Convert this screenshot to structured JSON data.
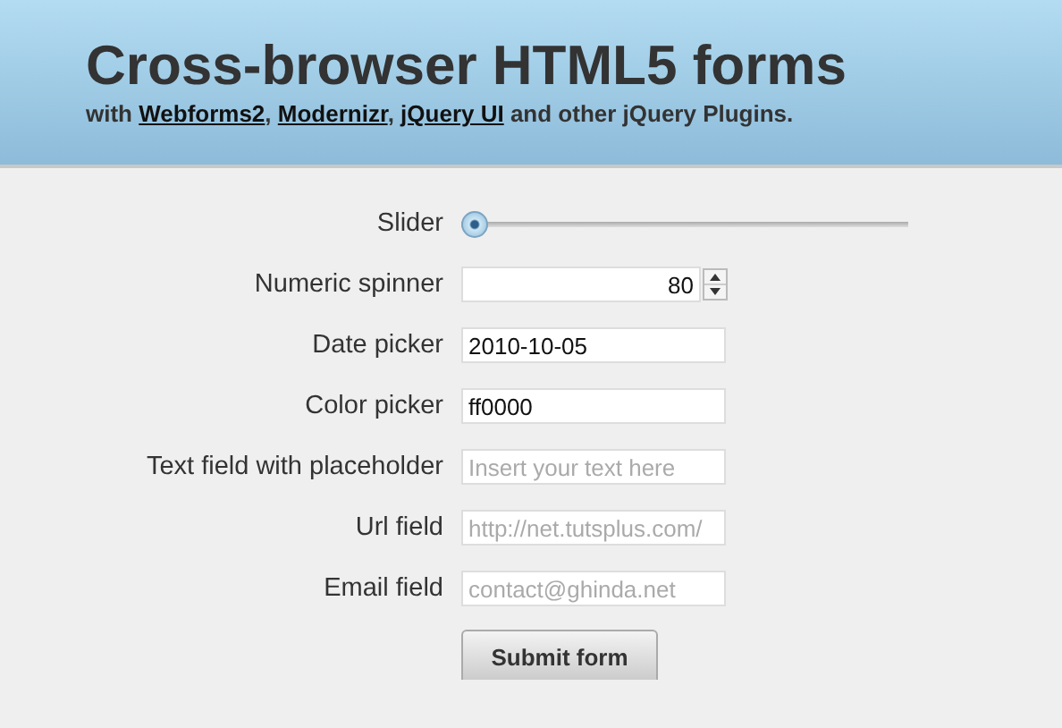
{
  "header": {
    "title": "Cross-browser HTML5 forms",
    "subtitle": [
      {
        "kind": "text",
        "text": "with "
      },
      {
        "kind": "link",
        "text": "Webforms2"
      },
      {
        "kind": "text",
        "text": ", "
      },
      {
        "kind": "link",
        "text": "Modernizr"
      },
      {
        "kind": "text",
        "text": ", "
      },
      {
        "kind": "link",
        "text": "jQuery UI"
      },
      {
        "kind": "text",
        "text": " and other jQuery Plugins."
      }
    ]
  },
  "form": {
    "fields": [
      {
        "kind": "slider",
        "label": "Slider",
        "level": 0
      },
      {
        "kind": "spinner",
        "label": "Numeric spinner",
        "value": "80"
      },
      {
        "kind": "text",
        "label": "Date picker",
        "value": "2010-10-05"
      },
      {
        "kind": "text",
        "label": "Color picker",
        "value": "ff0000"
      },
      {
        "kind": "text",
        "label": "Text field with placeholder",
        "placeholder": "Insert your text here"
      },
      {
        "kind": "text",
        "label": "Url field",
        "placeholder": "http://net.tutsplus.com/"
      },
      {
        "kind": "text",
        "label": "Email field",
        "placeholder": "contact@ghinda.net"
      }
    ],
    "submit": "Submit form"
  }
}
